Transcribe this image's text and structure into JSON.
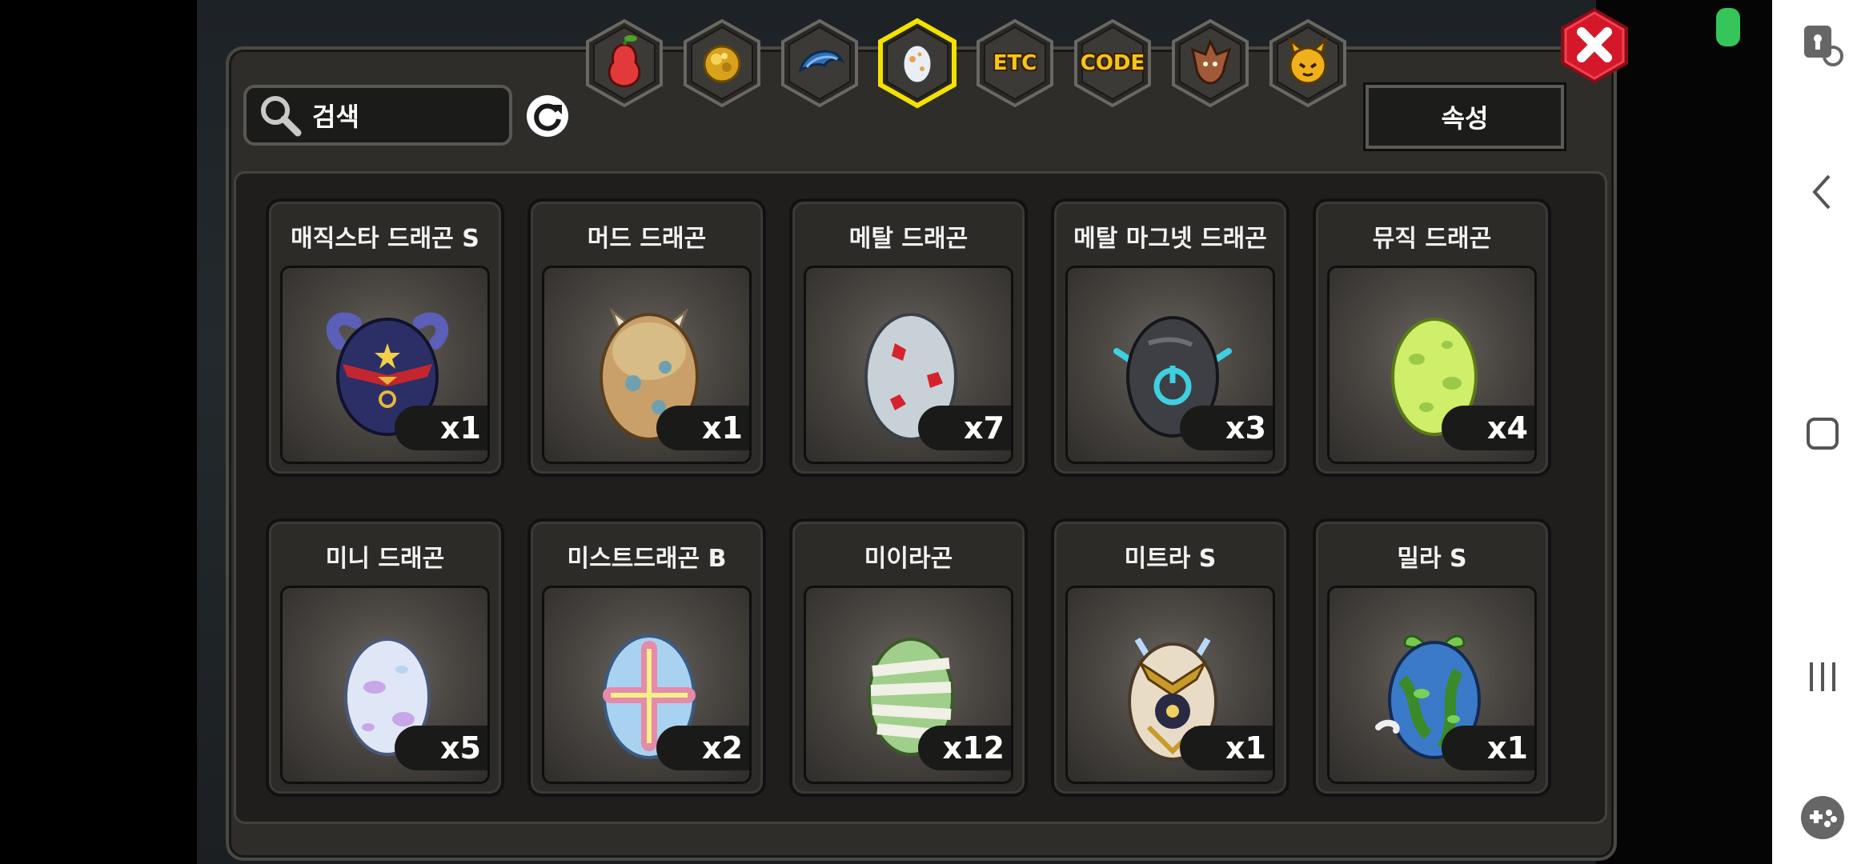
{
  "search": {
    "placeholder": "검색",
    "icon": "search-icon"
  },
  "attribute_button": {
    "label": "속성"
  },
  "tabs": [
    {
      "name": "tab-fruit",
      "icon": "pear-icon",
      "label": ""
    },
    {
      "name": "tab-coin",
      "icon": "gold-orb-icon",
      "label": ""
    },
    {
      "name": "tab-wing",
      "icon": "blue-scale-icon",
      "label": ""
    },
    {
      "name": "tab-egg",
      "icon": "egg-icon",
      "label": "",
      "selected": true
    },
    {
      "name": "tab-etc",
      "icon": "etc-icon",
      "label": "ETC"
    },
    {
      "name": "tab-code",
      "icon": "code-icon",
      "label": "CODE"
    },
    {
      "name": "tab-dragon",
      "icon": "dragon-head-icon",
      "label": ""
    },
    {
      "name": "tab-pet",
      "icon": "pet-face-icon",
      "label": ""
    }
  ],
  "items": [
    {
      "name": "매직스타 드래곤 S",
      "count": "x1",
      "egg": "magicstar"
    },
    {
      "name": "머드 드래곤",
      "count": "x1",
      "egg": "mud"
    },
    {
      "name": "메탈 드래곤",
      "count": "x7",
      "egg": "metal"
    },
    {
      "name": "메탈 마그넷 드래곤",
      "count": "x3",
      "egg": "magnet"
    },
    {
      "name": "뮤직 드래곤",
      "count": "x4",
      "egg": "music"
    },
    {
      "name": "미니 드래곤",
      "count": "x5",
      "egg": "mini"
    },
    {
      "name": "미스트드래곤 B",
      "count": "x2",
      "egg": "mist"
    },
    {
      "name": "미이라곤",
      "count": "x12",
      "egg": "mummy"
    },
    {
      "name": "미트라 S",
      "count": "x1",
      "egg": "mitra"
    },
    {
      "name": "밀라 S",
      "count": "x1",
      "egg": "mila"
    }
  ],
  "colors": {
    "tab_selected": "#f5e100",
    "close_red": "#d4182a",
    "panel": "#2e2d2a"
  },
  "system_nav": {
    "icons": [
      "touch-lock-icon",
      "back-icon",
      "home-icon",
      "recents-icon",
      "game-tools-icon"
    ]
  }
}
